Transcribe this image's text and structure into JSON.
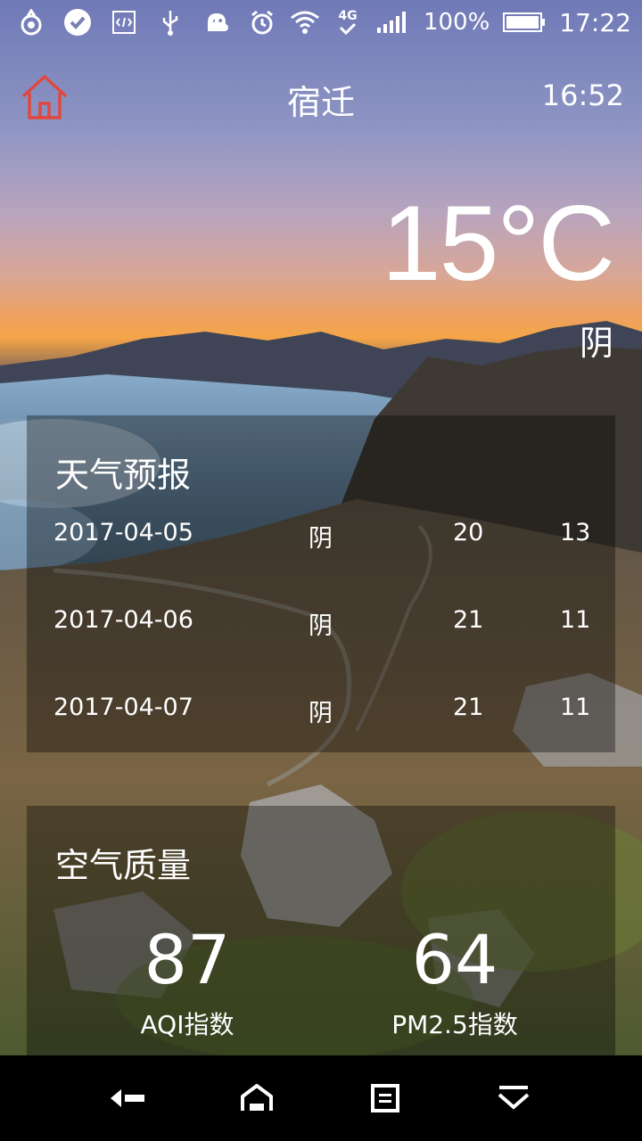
{
  "status_bar": {
    "left_icons": [
      "app-icon",
      "check-circle-icon",
      "code-icon",
      "usb-icon",
      "android-icon"
    ],
    "network": "4G",
    "battery": "100%",
    "time": "17:22"
  },
  "header": {
    "city": "宿迁",
    "update_time": "16:52",
    "home_icon": "home-icon",
    "home_color": "#e0483e"
  },
  "current": {
    "temperature": "15°C",
    "condition": "阴"
  },
  "forecast": {
    "title": "天气预报",
    "rows": [
      {
        "date": "2017-04-05",
        "weather": "阴",
        "high": "20",
        "low": "13"
      },
      {
        "date": "2017-04-06",
        "weather": "阴",
        "high": "21",
        "low": "11"
      },
      {
        "date": "2017-04-07",
        "weather": "阴",
        "high": "21",
        "low": "11"
      }
    ]
  },
  "air_quality": {
    "title": "空气质量",
    "aqi_value": "87",
    "aqi_label": "AQI指数",
    "pm25_value": "64",
    "pm25_label": "PM2.5指数"
  },
  "nav_bar": {
    "buttons": [
      "back-icon",
      "home-icon",
      "recents-icon",
      "hide-keyboard-icon"
    ]
  }
}
